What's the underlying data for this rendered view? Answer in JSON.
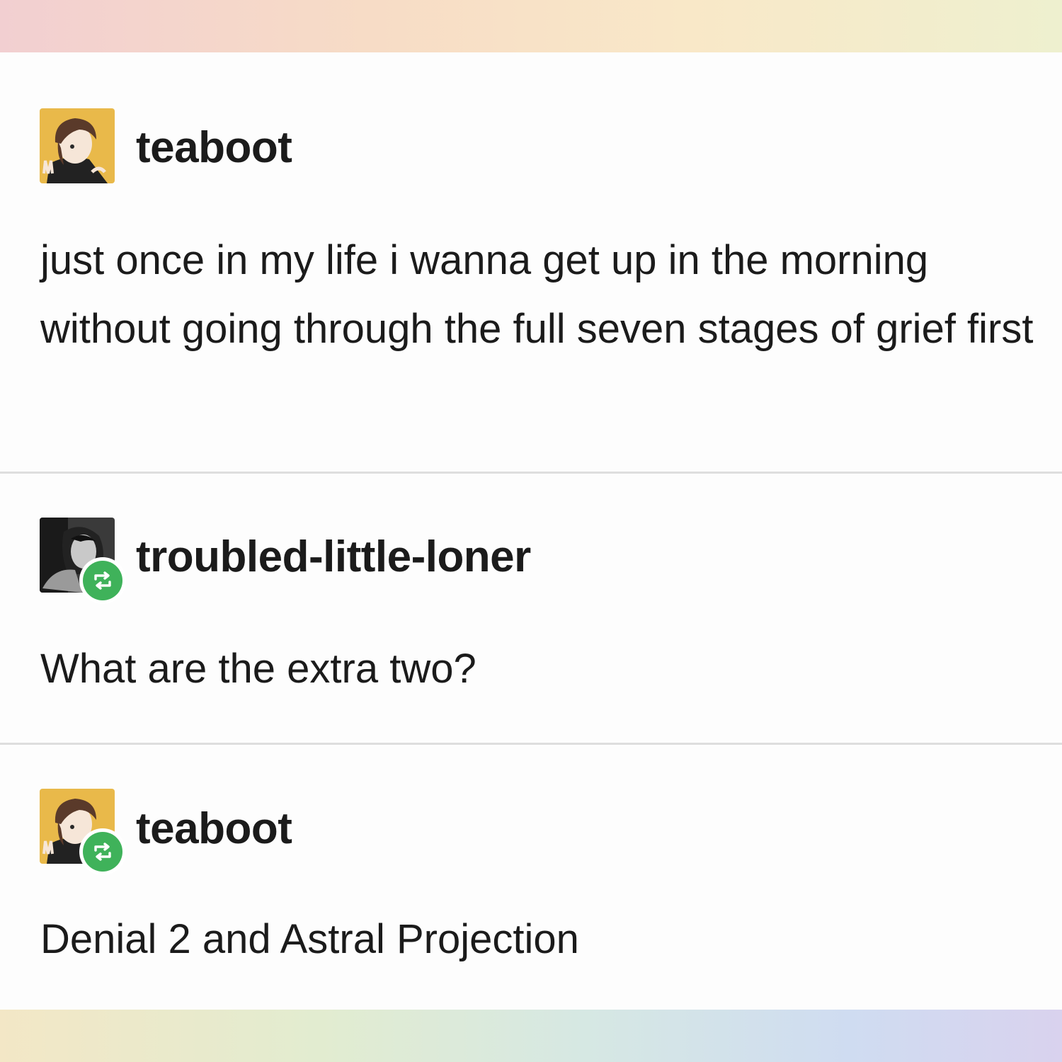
{
  "thread": {
    "entries": [
      {
        "username": "teaboot",
        "avatar": "teaboot-avatar",
        "reblog_badge": false,
        "text": "just once in my life i wanna get up in the morning without going through the full seven stages of grief first"
      },
      {
        "username": "troubled-little-loner",
        "avatar": "troubled-little-loner-avatar",
        "reblog_badge": true,
        "text": "What are the extra two?"
      },
      {
        "username": "teaboot",
        "avatar": "teaboot-avatar",
        "reblog_badge": true,
        "text": "Denial 2 and Astral Projection"
      }
    ]
  },
  "colors": {
    "reblog_green": "#3fb25a",
    "text": "#1b1b1b",
    "divider": "#dedede",
    "card_background": "#fdfdfd"
  },
  "icons": {
    "reblog": "reblog-icon"
  }
}
